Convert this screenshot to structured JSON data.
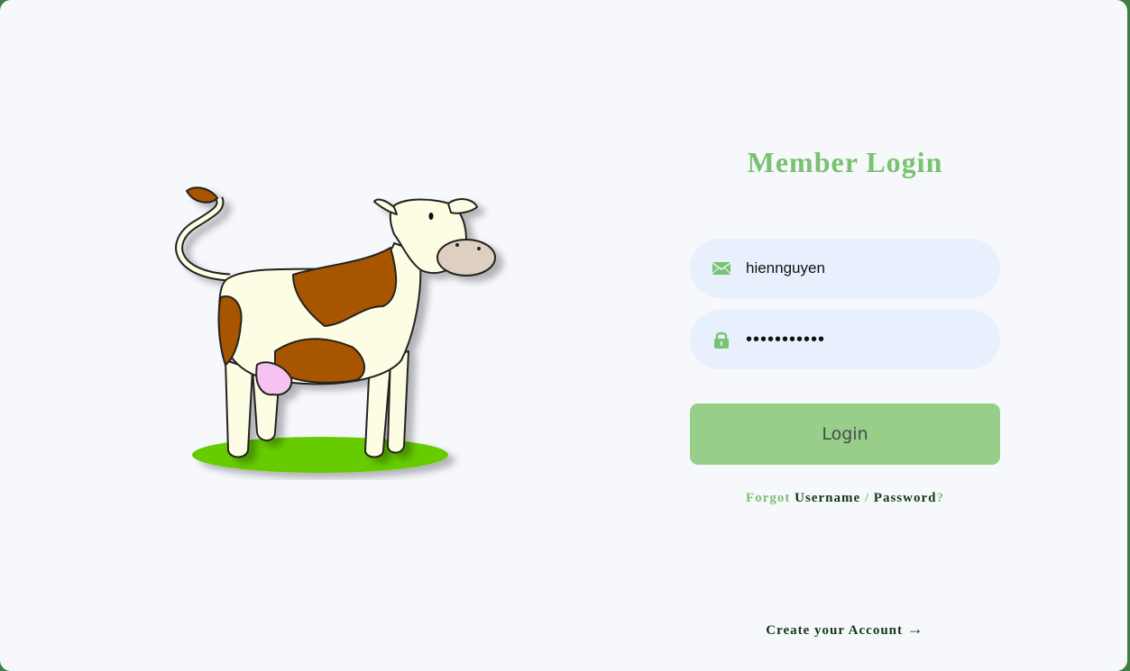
{
  "login": {
    "title": "Member Login",
    "username": {
      "value": "hiennguyen",
      "icon": "envelope-icon"
    },
    "password": {
      "value": "•••••••••••",
      "icon": "lock-icon"
    },
    "button_label": "Login",
    "forgot": {
      "prefix": "Forgot",
      "username_link": "Username",
      "separator": "/",
      "password_link": "Password",
      "suffix": "?"
    },
    "create_account": "Create your Account",
    "create_account_arrow": "→"
  },
  "colors": {
    "accent": "#79c270",
    "button": "#97cf8a",
    "input_bg": "#e8f0fe",
    "dark_link": "#0f3a14",
    "frame": "#3f7f45"
  }
}
